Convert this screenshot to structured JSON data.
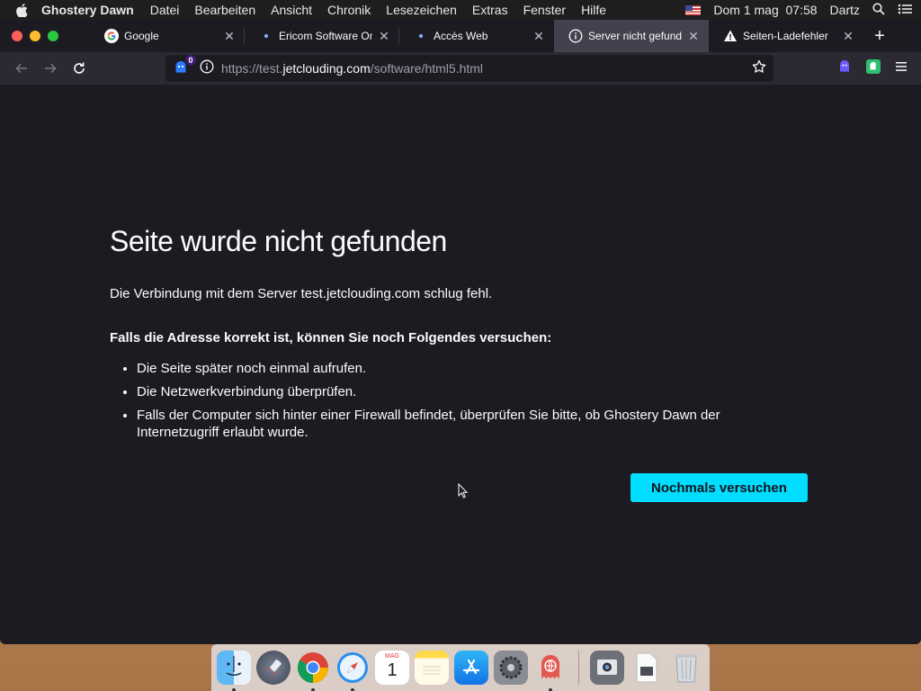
{
  "menubar": {
    "app_name": "Ghostery Dawn",
    "menus": [
      "Datei",
      "Bearbeiten",
      "Ansicht",
      "Chronik",
      "Lesezeichen",
      "Extras",
      "Fenster",
      "Hilfe"
    ],
    "clock": "Dom 1 mag  07:58",
    "user": "Dartz"
  },
  "tabs": [
    {
      "label": "Google",
      "icon": "google-icon"
    },
    {
      "label": "Ericom Software Onli",
      "icon": "dot-icon"
    },
    {
      "label": "Accès Web",
      "icon": "dot-icon"
    },
    {
      "label": "Server nicht gefunde",
      "icon": "info-icon",
      "active": true
    },
    {
      "label": "Seiten-Ladefehler",
      "icon": "warning-icon"
    }
  ],
  "navbar": {
    "ghostery_count": "0",
    "url_prefix": "https://test.",
    "url_host": "jetclouding.com",
    "url_path": "/software/html5.html"
  },
  "error_page": {
    "title": "Seite wurde nicht gefunden",
    "description": "Die Verbindung mit dem Server test.jetclouding.com schlug fehl.",
    "subtitle": "Falls die Adresse korrekt ist, können Sie noch Folgendes versuchen:",
    "suggestions": [
      "Die Seite später noch einmal aufrufen.",
      "Die Netzwerkverbindung überprüfen.",
      "Falls der Computer sich hinter einer Firewall befindet, überprüfen Sie bitte, ob Ghostery Dawn der Internetzugriff erlaubt wurde."
    ],
    "retry_label": "Nochmals versuchen"
  },
  "dock": {
    "calendar_month": "MAG",
    "calendar_day": "1"
  },
  "colors": {
    "accent": "#00ddff",
    "page_background": "#1c1b22",
    "toolbar": "#2b2a33"
  }
}
